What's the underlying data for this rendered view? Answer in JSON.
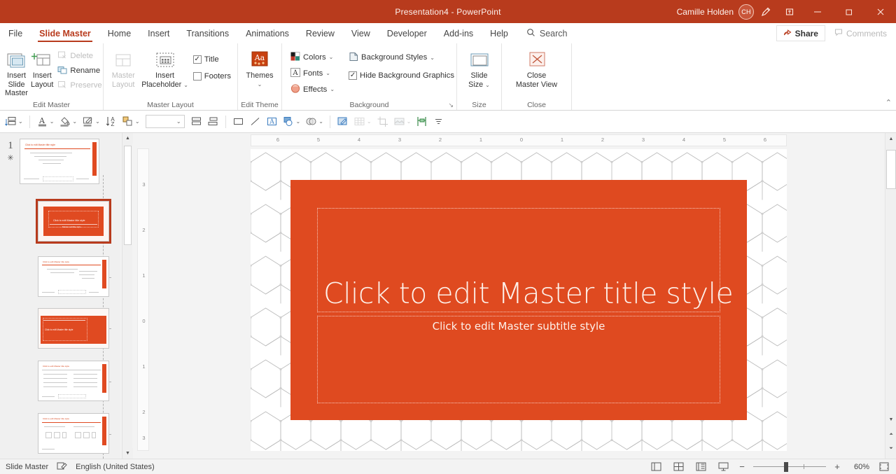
{
  "titlebar": {
    "document_title": "Presentation4  -  PowerPoint",
    "user_name": "Camille Holden",
    "avatar_initials": "CH",
    "pen_icon": "pen-icon",
    "restore_down_icon": "restore-down-icon",
    "minimize_label": "—",
    "maximize_label": "❐",
    "close_label": "✕",
    "brand_color": "#b83b1d"
  },
  "tabs": [
    {
      "label": "File",
      "active": false
    },
    {
      "label": "Slide Master",
      "active": true
    },
    {
      "label": "Home",
      "active": false
    },
    {
      "label": "Insert",
      "active": false
    },
    {
      "label": "Transitions",
      "active": false
    },
    {
      "label": "Animations",
      "active": false
    },
    {
      "label": "Review",
      "active": false
    },
    {
      "label": "View",
      "active": false
    },
    {
      "label": "Developer",
      "active": false
    },
    {
      "label": "Add-ins",
      "active": false
    },
    {
      "label": "Help",
      "active": false
    }
  ],
  "search": {
    "label": "Search",
    "icon": "search-icon"
  },
  "share": {
    "label": "Share",
    "icon": "share-icon"
  },
  "comments": {
    "label": "Comments",
    "icon": "comment-icon"
  },
  "ribbon": {
    "groups": [
      {
        "name": "Edit Master",
        "label": "Edit Master",
        "big_buttons": [
          {
            "line1": "Insert Slide",
            "line2": "Master",
            "icon": "insert-slide-master-icon",
            "disabled": false
          },
          {
            "line1": "Insert",
            "line2": "Layout",
            "icon": "insert-layout-icon",
            "disabled": false
          }
        ],
        "small_buttons": [
          {
            "label": "Delete",
            "icon": "delete-icon",
            "disabled": true
          },
          {
            "label": "Rename",
            "icon": "rename-icon",
            "disabled": false
          },
          {
            "label": "Preserve",
            "icon": "preserve-icon",
            "disabled": true
          }
        ]
      },
      {
        "name": "Master Layout",
        "label": "Master Layout",
        "big_buttons": [
          {
            "line1": "Master",
            "line2": "Layout",
            "icon": "master-layout-icon",
            "disabled": true
          },
          {
            "line1": "Insert",
            "line2": "Placeholder",
            "icon": "insert-placeholder-icon",
            "disabled": false,
            "caret": true
          }
        ],
        "checkboxes": [
          {
            "label": "Title",
            "checked": true
          },
          {
            "label": "Footers",
            "checked": false
          }
        ]
      },
      {
        "name": "Edit Theme",
        "label": "Edit Theme",
        "big_buttons": [
          {
            "line1": "Themes",
            "line2": "⌄",
            "icon": "themes-icon",
            "disabled": false
          }
        ]
      },
      {
        "name": "Background",
        "label": "Background",
        "small_buttons": [
          {
            "label": "Colors",
            "icon": "colors-icon",
            "caret": true
          },
          {
            "label": "Fonts",
            "icon": "fonts-icon",
            "caret": true
          },
          {
            "label": "Effects",
            "icon": "effects-icon",
            "caret": true
          },
          {
            "label": "Background Styles",
            "icon": "background-styles-icon",
            "caret": true
          },
          {
            "label": "Hide Background Graphics",
            "icon": "checkbox-icon",
            "checked": true
          }
        ],
        "dialog_launcher": "↘"
      },
      {
        "name": "Size",
        "label": "Size",
        "big_buttons": [
          {
            "line1": "Slide",
            "line2": "Size",
            "icon": "slide-size-icon",
            "caret": true
          }
        ]
      },
      {
        "name": "Close",
        "label": "Close",
        "big_buttons": [
          {
            "line1": "Close",
            "line2": "Master View",
            "icon": "close-master-view-icon"
          }
        ]
      }
    ],
    "collapse_icon": "collapse-ribbon-icon"
  },
  "toolbar": {
    "items": [
      {
        "name": "arrange-objects",
        "icon": "arrange-icon",
        "caret": true,
        "disabled": false
      },
      {
        "name": "text-color",
        "icon": "font-color-icon",
        "caret": true,
        "disabled": false
      },
      {
        "name": "shape-fill",
        "icon": "fill-color-icon",
        "caret": true,
        "disabled": false
      },
      {
        "name": "shape-outline",
        "icon": "shape-outline-icon",
        "caret": true,
        "disabled": false
      },
      {
        "name": "text-direction",
        "icon": "text-direction-icon",
        "caret": false,
        "disabled": false
      },
      {
        "name": "align-objects",
        "icon": "align-objects-icon",
        "caret": true,
        "disabled": false
      },
      {
        "name": "shape-style-gallery",
        "icon": "style-gallery-combo",
        "caret": true,
        "disabled": false
      },
      {
        "name": "align-middle",
        "icon": "align-middle-icon",
        "caret": false,
        "disabled": false
      },
      {
        "name": "distribute",
        "icon": "distribute-icon",
        "caret": false,
        "disabled": false
      },
      {
        "name": "rectangle-shape",
        "icon": "rectangle-icon",
        "caret": false,
        "disabled": false
      },
      {
        "name": "line-shape",
        "icon": "line-icon",
        "caret": false,
        "disabled": false
      },
      {
        "name": "text-box",
        "icon": "text-box-icon",
        "caret": false,
        "disabled": false
      },
      {
        "name": "shapes-gallery",
        "icon": "shapes-icon",
        "caret": true,
        "disabled": false
      },
      {
        "name": "merge-shapes",
        "icon": "merge-shapes-icon",
        "caret": true,
        "disabled": false
      },
      {
        "name": "format-shape",
        "icon": "format-shape-icon",
        "caret": false,
        "disabled": false
      },
      {
        "name": "table-tools",
        "icon": "table-icon",
        "caret": true,
        "disabled": true
      },
      {
        "name": "crop-tool",
        "icon": "crop-icon",
        "caret": false,
        "disabled": true
      },
      {
        "name": "picture-tools",
        "icon": "picture-icon",
        "caret": true,
        "disabled": true
      },
      {
        "name": "guides",
        "icon": "guides-icon",
        "caret": false,
        "disabled": false
      },
      {
        "name": "more-commands",
        "icon": "overflow-icon",
        "caret": false,
        "disabled": false
      }
    ],
    "style_combo_value": ""
  },
  "thumbnails": {
    "master_number": "1",
    "master_marker": "✳",
    "items": [
      {
        "name": "slide-master",
        "title": "Click to edit Master title style",
        "type": "master",
        "selected": false
      },
      {
        "name": "title-slide-layout",
        "title": "Click to edit Master title style",
        "subtitle": "Master subtitle style",
        "type": "title",
        "selected": true
      },
      {
        "name": "title-and-content-layout",
        "title": "Click to edit Master title style",
        "type": "content",
        "selected": false
      },
      {
        "name": "section-header-layout",
        "title": "Click to edit Master title style",
        "type": "section",
        "selected": false
      },
      {
        "name": "two-content-layout",
        "title": "Click to edit Master title style",
        "type": "two-content",
        "selected": false
      },
      {
        "name": "comparison-layout",
        "title": "Click to edit Master title style",
        "type": "comparison",
        "selected": false
      }
    ],
    "scroll_up_icon": "scroll-up-icon",
    "scroll_down_icon": "scroll-down-icon"
  },
  "rulers": {
    "horizontal_ticks": [
      "6",
      "5",
      "4",
      "3",
      "2",
      "1",
      "0",
      "1",
      "2",
      "3",
      "4",
      "5",
      "6"
    ],
    "vertical_ticks": [
      "3",
      "2",
      "1",
      "0",
      "1",
      "2",
      "3"
    ]
  },
  "slide": {
    "title_placeholder": "Click to edit Master title style",
    "subtitle_placeholder": "Click to edit Master subtitle style",
    "background_color": "#df4a20",
    "text_color": "#fdf0e9"
  },
  "scrollbar": {
    "up_icon": "scroll-up-icon",
    "down_icon": "scroll-down-icon",
    "prev_slide_icon": "previous-slide-icon",
    "next_slide_icon": "next-slide-icon"
  },
  "status": {
    "view_name": "Slide Master",
    "spellcheck_icon": "spellcheck-icon",
    "language": "English (United States)",
    "view_buttons": [
      {
        "name": "normal-view-button",
        "icon": "normal-view-icon"
      },
      {
        "name": "slide-sorter-button",
        "icon": "slide-sorter-icon"
      },
      {
        "name": "reading-view-button",
        "icon": "reading-view-icon"
      },
      {
        "name": "slideshow-button",
        "icon": "slideshow-icon"
      }
    ],
    "zoom_out_label": "−",
    "zoom_in_label": "+",
    "zoom_percent": "60%",
    "fit_icon": "fit-slide-icon"
  }
}
